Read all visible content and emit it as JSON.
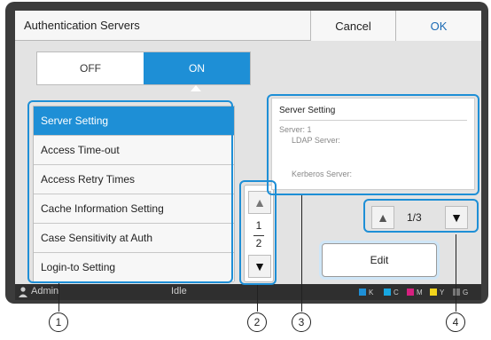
{
  "window": {
    "title": "Authentication Servers",
    "cancel_label": "Cancel",
    "ok_label": "OK"
  },
  "toggle": {
    "off_label": "OFF",
    "on_label": "ON",
    "selected": "ON"
  },
  "settings_list": {
    "items": [
      {
        "label": "Server Setting",
        "selected": true
      },
      {
        "label": "Access Time-out",
        "selected": false
      },
      {
        "label": "Access Retry Times",
        "selected": false
      },
      {
        "label": "Cache Information Setting",
        "selected": false
      },
      {
        "label": "Case Sensitivity at Auth",
        "selected": false
      },
      {
        "label": "Login-to Setting",
        "selected": false
      }
    ]
  },
  "list_pager": {
    "current": "1",
    "total": "2"
  },
  "info_panel": {
    "title": "Server Setting",
    "server_label": "Server: 1",
    "ldap_label": "LDAP Server:",
    "kerberos_label": "Kerberos Server:"
  },
  "server_pager": {
    "text": "1/3"
  },
  "edit_label": "Edit",
  "status_bar": {
    "user": "Admin",
    "state": "Idle",
    "inks": [
      {
        "label": "K",
        "color": "#111111"
      },
      {
        "label": "C",
        "color": "#17a6e0"
      },
      {
        "label": "M",
        "color": "#d6207f"
      },
      {
        "label": "Y",
        "color": "#f1d31b"
      },
      {
        "label": "G",
        "color": "#777777"
      }
    ]
  },
  "callouts": [
    "1",
    "2",
    "3",
    "4"
  ],
  "colors": {
    "accent": "#1e8fd6",
    "frame": "#3c3c3c"
  }
}
